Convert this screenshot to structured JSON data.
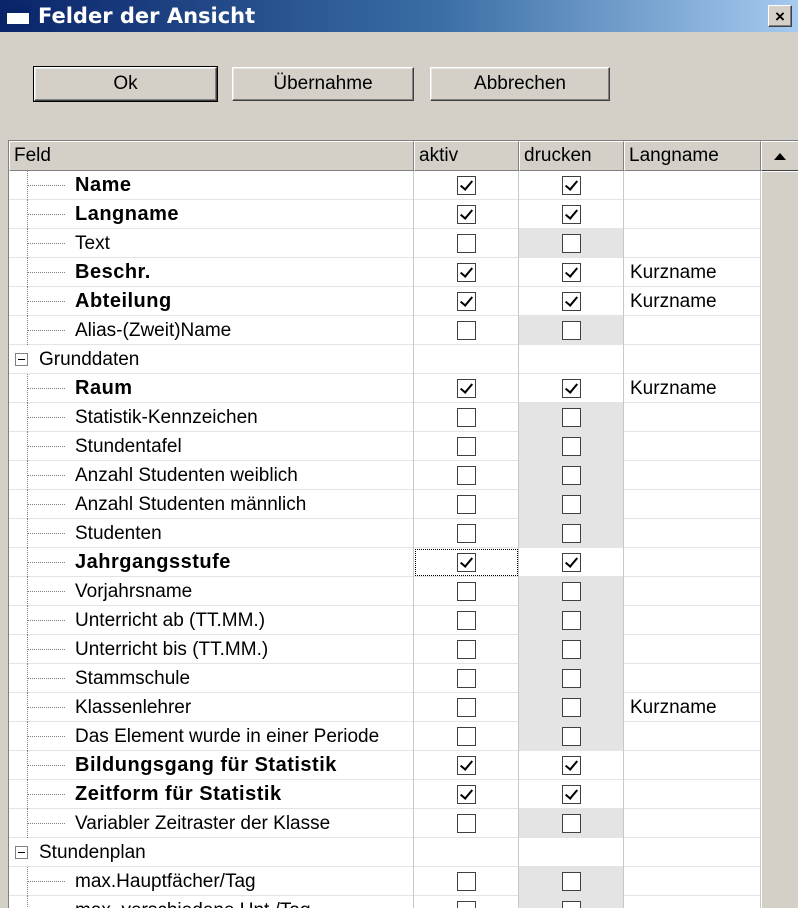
{
  "window": {
    "title": "Felder der Ansicht",
    "close_label": "×"
  },
  "buttons": {
    "ok": "Ok",
    "apply": "Übernahme",
    "cancel": "Abbrechen"
  },
  "columns": {
    "feld": "Feld",
    "aktiv": "aktiv",
    "drucken": "drucken",
    "langname": "Langname"
  },
  "rows": [
    {
      "label": "Name",
      "type": "field",
      "bold": true,
      "aktiv": true,
      "drucken": true,
      "grey": false,
      "langname": ""
    },
    {
      "label": "Langname",
      "type": "field",
      "bold": true,
      "aktiv": true,
      "drucken": true,
      "grey": false,
      "langname": ""
    },
    {
      "label": "Text",
      "type": "field",
      "bold": false,
      "aktiv": false,
      "drucken": false,
      "grey": true,
      "langname": ""
    },
    {
      "label": "Beschr.",
      "type": "field",
      "bold": true,
      "aktiv": true,
      "drucken": true,
      "grey": false,
      "langname": "Kurzname"
    },
    {
      "label": "Abteilung",
      "type": "field",
      "bold": true,
      "aktiv": true,
      "drucken": true,
      "grey": false,
      "langname": "Kurzname"
    },
    {
      "label": "Alias-(Zweit)Name",
      "type": "field",
      "bold": false,
      "aktiv": false,
      "drucken": false,
      "grey": true,
      "langname": ""
    },
    {
      "label": "Grunddaten",
      "type": "group"
    },
    {
      "label": "Raum",
      "type": "field",
      "bold": true,
      "aktiv": true,
      "drucken": true,
      "grey": false,
      "langname": "Kurzname"
    },
    {
      "label": "Statistik-Kennzeichen",
      "type": "field",
      "bold": false,
      "aktiv": false,
      "drucken": false,
      "grey": true,
      "langname": ""
    },
    {
      "label": "Stundentafel",
      "type": "field",
      "bold": false,
      "aktiv": false,
      "drucken": false,
      "grey": true,
      "langname": ""
    },
    {
      "label": "Anzahl Studenten weiblich",
      "type": "field",
      "bold": false,
      "aktiv": false,
      "drucken": false,
      "grey": true,
      "langname": ""
    },
    {
      "label": "Anzahl Studenten männlich",
      "type": "field",
      "bold": false,
      "aktiv": false,
      "drucken": false,
      "grey": true,
      "langname": ""
    },
    {
      "label": "Studenten",
      "type": "field",
      "bold": false,
      "aktiv": false,
      "drucken": false,
      "grey": true,
      "langname": ""
    },
    {
      "label": "Jahrgangsstufe",
      "type": "field",
      "bold": true,
      "aktiv": true,
      "drucken": true,
      "grey": false,
      "langname": "",
      "focus": true
    },
    {
      "label": "Vorjahrsname",
      "type": "field",
      "bold": false,
      "aktiv": false,
      "drucken": false,
      "grey": true,
      "langname": ""
    },
    {
      "label": "Unterricht ab (TT.MM.)",
      "type": "field",
      "bold": false,
      "aktiv": false,
      "drucken": false,
      "grey": true,
      "langname": ""
    },
    {
      "label": "Unterricht bis (TT.MM.)",
      "type": "field",
      "bold": false,
      "aktiv": false,
      "drucken": false,
      "grey": true,
      "langname": ""
    },
    {
      "label": "Stammschule",
      "type": "field",
      "bold": false,
      "aktiv": false,
      "drucken": false,
      "grey": true,
      "langname": ""
    },
    {
      "label": "Klassenlehrer",
      "type": "field",
      "bold": false,
      "aktiv": false,
      "drucken": false,
      "grey": true,
      "langname": "Kurzname"
    },
    {
      "label": "Das Element wurde in einer Periode",
      "type": "field",
      "bold": false,
      "aktiv": false,
      "drucken": false,
      "grey": true,
      "langname": ""
    },
    {
      "label": "Bildungsgang für Statistik",
      "type": "field",
      "bold": true,
      "aktiv": true,
      "drucken": true,
      "grey": false,
      "langname": ""
    },
    {
      "label": "Zeitform für Statistik",
      "type": "field",
      "bold": true,
      "aktiv": true,
      "drucken": true,
      "grey": false,
      "langname": ""
    },
    {
      "label": "Variabler Zeitraster der Klasse",
      "type": "field",
      "bold": false,
      "aktiv": false,
      "drucken": false,
      "grey": true,
      "langname": ""
    },
    {
      "label": "Stundenplan",
      "type": "group"
    },
    {
      "label": "max.Hauptfächer/Tag",
      "type": "field",
      "bold": false,
      "aktiv": false,
      "drucken": false,
      "grey": true,
      "langname": ""
    },
    {
      "label": "max. verschiedene Unt./Tag",
      "type": "field",
      "bold": false,
      "aktiv": false,
      "drucken": false,
      "grey": true,
      "langname": ""
    }
  ]
}
